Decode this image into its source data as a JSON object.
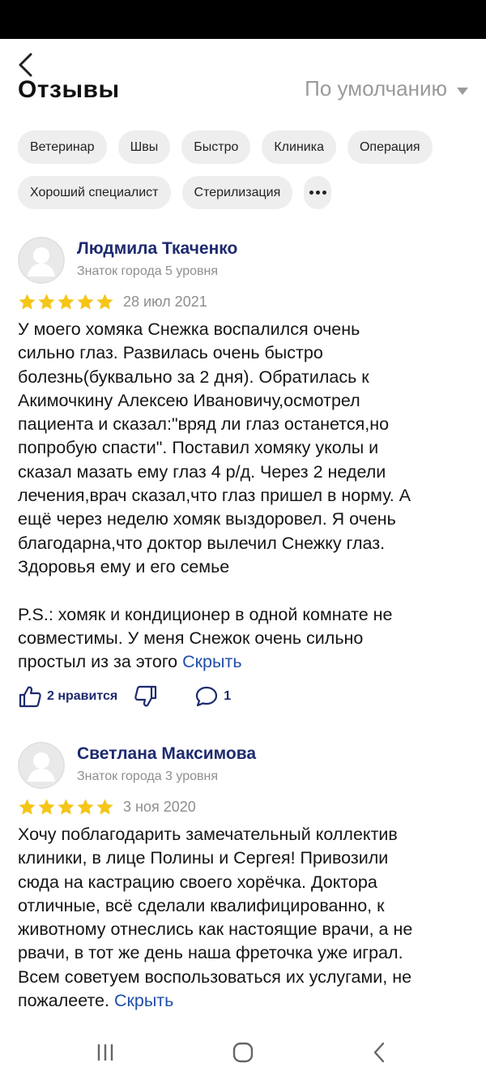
{
  "header": {
    "section_title": "Отзывы",
    "sort_label": "По умолчанию"
  },
  "chips": [
    [
      "Ветеринар",
      "Швы",
      "Быстро",
      "Клиника",
      "Операция"
    ],
    [
      "Хороший специалист",
      "Стерилизация"
    ]
  ],
  "reviews": [
    {
      "author": "Людмила Ткаченко",
      "level": "Знаток города 5 уровня",
      "rating": 5,
      "date": "28 июл 2021",
      "text": "У моего хомяка Снежка воспалился очень\nсильно глаз. Развилась очень быстро\nболезнь(буквально за 2 дня). Обратилась к\nАкимочкину Алексею Ивановичу,осмотрел\nпациента и сказал:\"вряд ли глаз останется,но\nпопробую спасти\". Поставил хомяку уколы и\nсказал мазать ему глаз 4 р/д. Через 2 недели\nлечения,врач сказал,что глаз пришел в норму. А\nещё через неделю хомяк выздоровел. Я очень\nблагодарна,что доктор вылечил Снежку глаз.\nЗдоровья ему и его семье\n\nP.S.: хомяк и кондиционер в одной комнате не\nсовместимы. У меня Снежок очень сильно\nпростыл из за этого ",
      "hide_label": "Скрыть",
      "likes_label": "2 нравится",
      "comments_count": "1"
    },
    {
      "author": "Светлана Максимова",
      "level": "Знаток города 3 уровня",
      "rating": 5,
      "date": "3 ноя 2020",
      "text": "Хочу поблагодарить замечательный коллектив\nклиники, в лице Полины и Сергея! Привозили\nсюда на кастрацию своего хорёчка. Доктора\nотличные, всё сделали квалифицированно, к\nживотному отнеслись как настоящие врачи, а не\nрвачи, в тот же день наша фреточка уже играл.\nВсем советуем воспользоваться их услугами, не\nпожалеете. ",
      "hide_label": "Скрыть"
    }
  ],
  "colors": {
    "star": "#F5C518",
    "author": "#1D2A6E",
    "link": "#1F4FA8",
    "chip_bg": "#EEEEEE"
  },
  "icons": {
    "back": "chevron-left-icon",
    "like": "thumbs-up-icon",
    "dislike": "thumbs-down-icon",
    "comment": "comment-bubble-icon",
    "more": "more-dots-icon",
    "nav_recents": "recents-icon",
    "nav_home": "home-icon",
    "nav_back": "nav-back-icon"
  }
}
